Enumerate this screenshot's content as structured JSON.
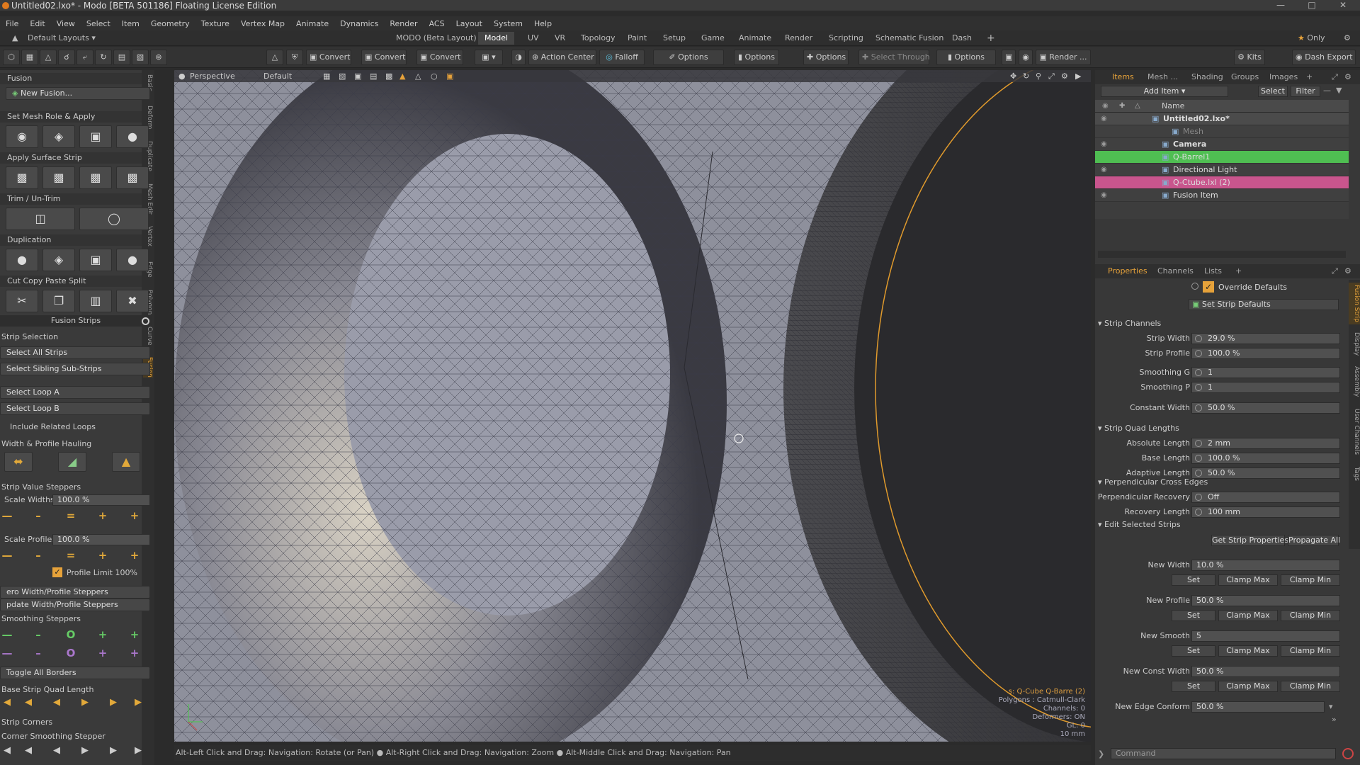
{
  "window": {
    "title": "Untitled02.lxo* - Modo [BETA 501186] Floating License Edition"
  },
  "menubar": [
    "File",
    "Edit",
    "View",
    "Select",
    "Item",
    "Geometry",
    "Texture",
    "Vertex Map",
    "Animate",
    "Dynamics",
    "Render",
    "ACS",
    "Layout",
    "System",
    "Help"
  ],
  "layoutbar": {
    "layouts_label": "Default Layouts",
    "tabs": [
      "MODO (Beta Layout)",
      "Model",
      "UV",
      "VR",
      "Topology",
      "Paint",
      "Setup",
      "Game",
      "Animate",
      "Render",
      "Scripting",
      "Schematic Fusion",
      "Dash"
    ],
    "active_tab": "Model",
    "only_label": "Only"
  },
  "toolbar": {
    "convert1": "Convert",
    "convert2": "Convert",
    "convert3": "Convert",
    "action_center": "Action Center",
    "falloff": "Falloff",
    "options1": "Options",
    "options2": "Options",
    "options3": "Options",
    "select_through": "Select Through",
    "options4": "Options",
    "render": "Render ...",
    "kits": "Kits",
    "dash_export": "Dash Export"
  },
  "leftpanel": {
    "vertical_tabs": [
      "Basic",
      "Deform",
      "Duplicate",
      "Mesh Edit",
      "Vertex",
      "Edge",
      "Polygon",
      "Curve",
      "Fusion"
    ],
    "fusion_header": "Fusion",
    "new_fusion": "New Fusion...",
    "set_mesh_role": "Set Mesh Role & Apply",
    "apply_surface_strip": "Apply Surface Strip",
    "trim": "Trim / Un-Trim",
    "duplication": "Duplication",
    "cut_copy": "Cut Copy Paste Split",
    "fusion_strips": "Fusion Strips",
    "strip_selection": "Strip Selection",
    "select_all_strips": "Select All Strips",
    "select_sibling": "Select Sibling Sub-Strips",
    "select_loop_a": "Select Loop A",
    "select_loop_b": "Select Loop B",
    "include_related": "Include Related Loops",
    "width_profile": "Width & Profile Hauling",
    "strip_value_steppers": "Strip Value Steppers",
    "scale_widths_label": "Scale Widths",
    "scale_widths_value": "100.0 %",
    "scale_profiles_label": "Scale Profiles",
    "scale_profiles_value": "100.0 %",
    "profile_limit": "Profile Limit 100%",
    "zero_steppers": "ero Width/Profile Steppers",
    "update_steppers": "pdate Width/Profile Steppers",
    "smoothing_steppers": "Smoothing Steppers",
    "toggle_all_borders": "Toggle All Borders",
    "base_strip_quad": "Base Strip Quad Length",
    "strip_corners": "Strip Corners",
    "corner_smoothing": "Corner Smoothing Stepper"
  },
  "viewport": {
    "view_label": "Perspective",
    "shading_label": "Default",
    "info": [
      "s: Q-Cube Q-Barre (2)",
      "Polygons : Catmull-Clark",
      "Channels: 0",
      "Deformers: ON",
      "GL: 0",
      "10 mm"
    ]
  },
  "statusbar": {
    "hint1": "Alt-Left Click and Drag: Navigation: Rotate (or Pan)",
    "hint2": "Alt-Right Click and Drag: Navigation: Zoom",
    "hint3": "Alt-Middle Click and Drag: Navigation: Pan"
  },
  "rightpanel": {
    "tabs": [
      "Items",
      "Mesh ...",
      "Shading",
      "Groups",
      "Images"
    ],
    "add_item": "Add Item",
    "select": "Select",
    "filter": "Filter",
    "name_col": "Name",
    "tree": [
      {
        "label": "Untitled02.lxo*",
        "indent": 0,
        "bold": true,
        "eye": true,
        "bg": "#4b4b4b"
      },
      {
        "label": "Mesh",
        "indent": 2,
        "bold": false,
        "eye": false,
        "bg": "#404040",
        "dim": true
      },
      {
        "label": "Camera",
        "indent": 1,
        "bold": true,
        "eye": true,
        "bg": "#404040"
      },
      {
        "label": "Q-Barrel1",
        "indent": 1,
        "bold": false,
        "eye": false,
        "bg": "#4fbe52"
      },
      {
        "label": "Directional Light",
        "indent": 1,
        "bold": false,
        "eye": true,
        "bg": "#404040"
      },
      {
        "label": "Q-Ctube.lxl (2)",
        "indent": 1,
        "bold": false,
        "eye": false,
        "bg": "#c9558d"
      },
      {
        "label": "Fusion Item",
        "indent": 1,
        "bold": false,
        "eye": true,
        "bg": "#404040"
      }
    ],
    "prop_tabs": [
      "Properties",
      "Channels",
      "Lists"
    ],
    "override_defaults": "Override Defaults",
    "set_strip_defaults": "Set Strip Defaults",
    "side_tabs": [
      "Fusion Strip",
      "Display",
      "Assembly",
      "User Channels",
      "Tags"
    ],
    "sections": {
      "strip_channels": "Strip Channels",
      "strip_quad": "Strip Quad Lengths",
      "perp": "Perpendicular Cross Edges",
      "edit": "Edit Selected Strips"
    },
    "props": [
      {
        "label": "Strip Width",
        "value": "29.0 %"
      },
      {
        "label": "Strip Profile",
        "value": "100.0 %"
      },
      {
        "label": "Smoothing G",
        "value": "1"
      },
      {
        "label": "Smoothing P",
        "value": "1"
      },
      {
        "label": "Constant Width",
        "value": "50.0 %"
      },
      {
        "label": "Absolute Length",
        "value": "2 mm"
      },
      {
        "label": "Base Length",
        "value": "100.0 %"
      },
      {
        "label": "Adaptive Length",
        "value": "50.0 %"
      },
      {
        "label": "Perpendicular Recovery",
        "value": "Off"
      },
      {
        "label": "Recovery Length",
        "value": "100 mm"
      }
    ],
    "get_strip_props": "Get Strip Properties",
    "propagate_all": "Propagate All",
    "edits": [
      {
        "label": "New Width",
        "value": "10.0 %"
      },
      {
        "label": "New Profile",
        "value": "50.0 %"
      },
      {
        "label": "New Smooth",
        "value": "5"
      },
      {
        "label": "New Const Width",
        "value": "50.0 %"
      }
    ],
    "set": "Set",
    "clamp_max": "Clamp Max",
    "clamp_min": "Clamp Min",
    "new_edge_conform_label": "New Edge Conform",
    "new_edge_conform_value": "50.0 %",
    "command_placeholder": "Command"
  }
}
